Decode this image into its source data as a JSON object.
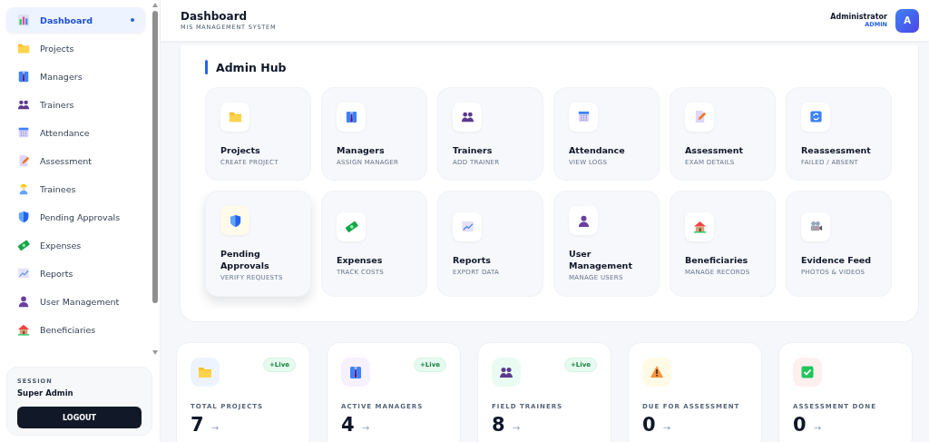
{
  "sidebar": {
    "items": [
      {
        "label": "Dashboard",
        "selected": true
      },
      {
        "label": "Projects",
        "selected": false
      },
      {
        "label": "Managers",
        "selected": false
      },
      {
        "label": "Trainers",
        "selected": false
      },
      {
        "label": "Attendance",
        "selected": false
      },
      {
        "label": "Assessment",
        "selected": false
      },
      {
        "label": "Trainees",
        "selected": false
      },
      {
        "label": "Pending Approvals",
        "selected": false
      },
      {
        "label": "Expenses",
        "selected": false
      },
      {
        "label": "Reports",
        "selected": false
      },
      {
        "label": "User Management",
        "selected": false
      },
      {
        "label": "Beneficiaries",
        "selected": false
      }
    ],
    "session": {
      "label": "SESSION",
      "user": "Super Admin",
      "button": "LOGOUT"
    }
  },
  "header": {
    "title": "Dashboard",
    "subtitle": "MIS MANAGEMENT SYSTEM",
    "user_name": "Administrator",
    "user_role": "ADMIN",
    "avatar": "A"
  },
  "admin_hub": {
    "title": "Admin Hub",
    "tiles": [
      {
        "title": "Projects",
        "subtitle": "CREATE PROJECT",
        "highlighted": false
      },
      {
        "title": "Managers",
        "subtitle": "ASSIGN MANAGER",
        "highlighted": false
      },
      {
        "title": "Trainers",
        "subtitle": "ADD TRAINER",
        "highlighted": false
      },
      {
        "title": "Attendance",
        "subtitle": "VIEW LOGS",
        "highlighted": false
      },
      {
        "title": "Assessment",
        "subtitle": "EXAM DETAILS",
        "highlighted": false
      },
      {
        "title": "Reassessment",
        "subtitle": "FAILED / ABSENT",
        "highlighted": false
      },
      {
        "title": "Pending Approvals",
        "subtitle": "VERIFY REQUESTS",
        "highlighted": true
      },
      {
        "title": "Expenses",
        "subtitle": "TRACK COSTS",
        "highlighted": false
      },
      {
        "title": "Reports",
        "subtitle": "EXPORT DATA",
        "highlighted": false
      },
      {
        "title": "User Management",
        "subtitle": "MANAGE USERS",
        "highlighted": false
      },
      {
        "title": "Beneficiaries",
        "subtitle": "MANAGE RECORDS",
        "highlighted": false
      },
      {
        "title": "Evidence Feed",
        "subtitle": "PHOTOS & VIDEOS",
        "highlighted": false
      }
    ]
  },
  "stats": [
    {
      "label": "TOTAL PROJECTS",
      "value": "7",
      "arrow": "→",
      "badge": "+Live"
    },
    {
      "label": "ACTIVE MANAGERS",
      "value": "4",
      "arrow": "→",
      "badge": "+Live"
    },
    {
      "label": "FIELD TRAINERS",
      "value": "8",
      "arrow": "→",
      "badge": "+Live"
    },
    {
      "label": "DUE FOR ASSESSMENT",
      "value": "0",
      "arrow": "→"
    },
    {
      "label": "ASSESSMENT DONE",
      "value": "0",
      "arrow": "→"
    }
  ]
}
